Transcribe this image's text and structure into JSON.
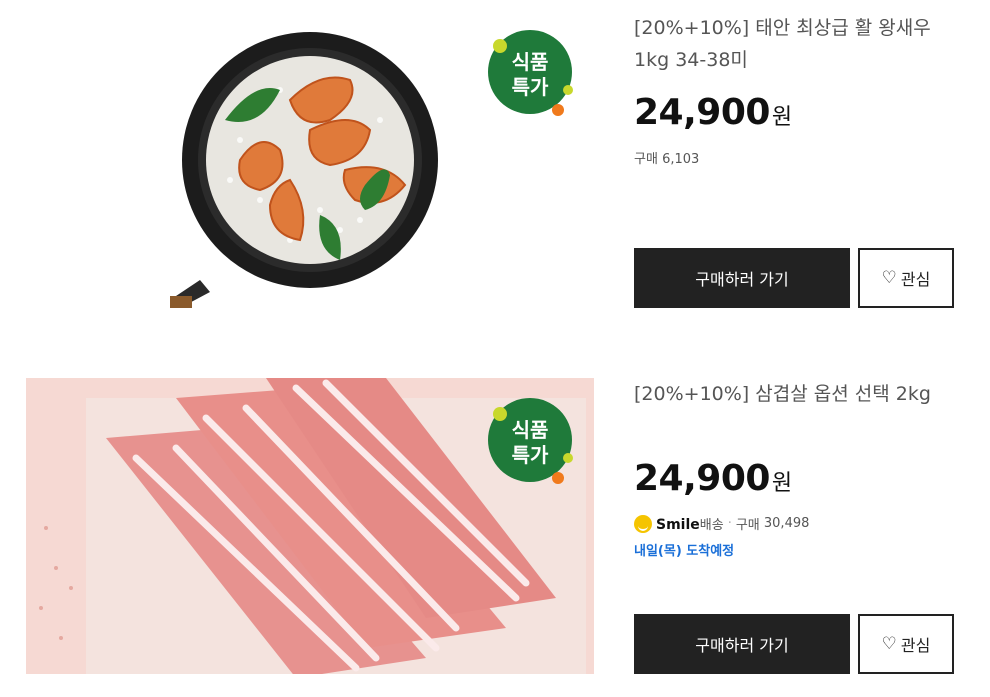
{
  "products": [
    {
      "title": "[20%+10%] 태안 최상급 활 왕새우 1kg 34-38미",
      "price": "24,900",
      "price_unit": "원",
      "purchase_label": "구매",
      "purchase_count": "6,103",
      "badge": {
        "line1": "식품",
        "line2": "특가"
      },
      "buy_label": "구매하러 가기",
      "wish_label": "관심"
    },
    {
      "title": "[20%+10%] 삼겹살 옵션 선택 2kg",
      "price": "24,900",
      "price_unit": "원",
      "smile_brand": "Smile",
      "smile_suffix": "배송",
      "purchase_label": "구매",
      "purchase_count": "30,498",
      "delivery": "내일(목) 도착예정",
      "badge": {
        "line1": "식품",
        "line2": "특가"
      },
      "buy_label": "구매하러 가기",
      "wish_label": "관심"
    }
  ],
  "colors": {
    "badge_green": "#1f7a3a",
    "badge_dot_yellow": "#c8d82c",
    "badge_dot_orange": "#f07a1c",
    "smile_yellow": "#f5c400",
    "delivery_blue": "#1a6fd8",
    "button_dark": "#222222"
  },
  "icons": {
    "wish": "heart-outline-icon",
    "smile": "smile-delivery-icon"
  }
}
